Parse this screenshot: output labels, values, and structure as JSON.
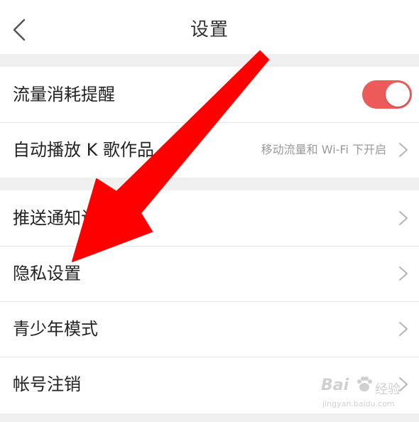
{
  "navbar": {
    "title": "设置",
    "back_icon": "chevron-left-icon"
  },
  "groups": [
    {
      "rows": [
        {
          "label": "流量消耗提醒",
          "control": "toggle",
          "toggle_on": true
        },
        {
          "label": "自动播放 K 歌作品",
          "value": "移动流量和 Wi-Fi 下开启",
          "control": "chevron"
        }
      ]
    },
    {
      "rows": [
        {
          "label": "推送通知设置",
          "control": "chevron"
        },
        {
          "label": "隐私设置",
          "control": "chevron"
        },
        {
          "label": "青少年模式",
          "control": "chevron"
        },
        {
          "label": "帐号注销",
          "control": "chevron"
        }
      ]
    }
  ],
  "watermark": {
    "brand": "Bai",
    "brand_suffix": "经验",
    "url": "jingyan.baidu.com"
  },
  "colors": {
    "toggle_on": "#ec5a5a",
    "annotation_arrow": "#ff0000",
    "background": "#f0f0f0",
    "text": "#222222",
    "secondary_text": "#9a9a9a"
  }
}
